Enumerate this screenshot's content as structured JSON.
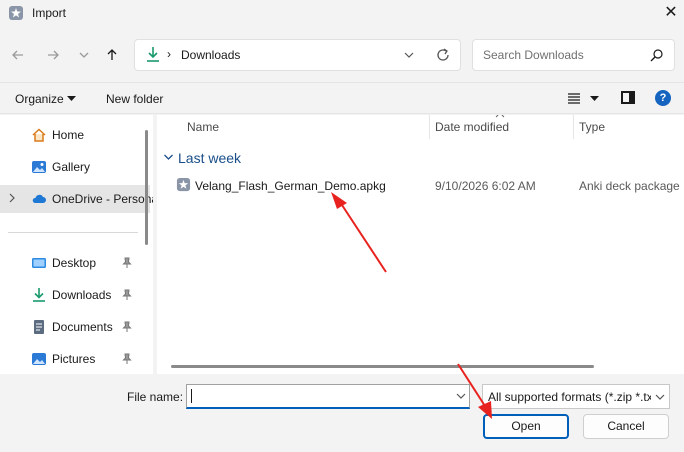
{
  "window": {
    "title": "Import",
    "close_glyph": "✕"
  },
  "nav": {
    "back_icon": "arrow-left-icon",
    "forward_icon": "arrow-right-icon",
    "recent_icon": "chevron-down-icon",
    "up_icon": "arrow-up-icon"
  },
  "address": {
    "location": "Downloads",
    "separator": "›"
  },
  "search": {
    "placeholder": "Search Downloads"
  },
  "toolbar": {
    "organize_label": "Organize",
    "new_folder_label": "New folder",
    "help_glyph": "?"
  },
  "sidebar": {
    "items": [
      {
        "label": "Home",
        "icon": "home-icon"
      },
      {
        "label": "Gallery",
        "icon": "gallery-icon"
      },
      {
        "label": "OneDrive - Personal",
        "icon": "cloud-icon",
        "selected": true
      },
      {
        "label": "Desktop",
        "icon": "desktop-icon",
        "pinned": true
      },
      {
        "label": "Downloads",
        "icon": "download-icon",
        "pinned": true
      },
      {
        "label": "Documents",
        "icon": "document-icon",
        "pinned": true
      },
      {
        "label": "Pictures",
        "icon": "picture-icon",
        "pinned": true
      }
    ]
  },
  "filelist": {
    "columns": {
      "name": "Name",
      "date": "Date modified",
      "type": "Type"
    },
    "group_label": "Last week",
    "files": [
      {
        "name": "Velang_Flash_German_Demo.apkg",
        "date": "9/10/2026 6:02 AM",
        "type": "Anki deck package"
      }
    ]
  },
  "bottom": {
    "file_name_label": "File name:",
    "file_name_value": "",
    "file_type_value": "All supported formats (*.zip *.txt",
    "open_label": "Open",
    "cancel_label": "Cancel"
  },
  "colors": {
    "accent": "#005fb8",
    "annotation_arrow": "#e8231f",
    "group_header": "#1a4e8a"
  }
}
